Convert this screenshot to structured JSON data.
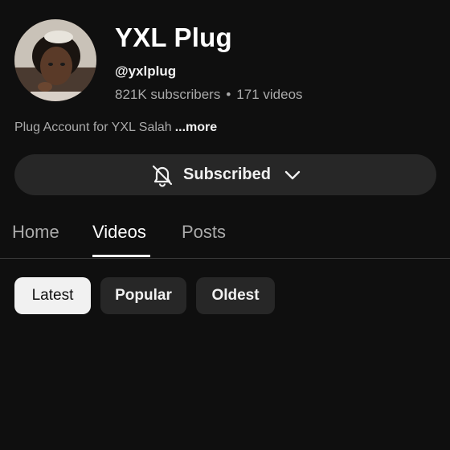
{
  "channel": {
    "name": "YXL Plug",
    "handle": "@yxlplug",
    "subscribers": "821K subscribers",
    "separator": "•",
    "videos": "171 videos",
    "description": "Plug Account for YXL Salah",
    "more_label": "...more",
    "avatar_icon": "profile-photo"
  },
  "subscribe_button": {
    "label": "Subscribed",
    "bell_icon": "bell-off-icon",
    "chevron_icon": "chevron-down-icon"
  },
  "tabs": [
    {
      "label": "Home",
      "active": false
    },
    {
      "label": "Videos",
      "active": true
    },
    {
      "label": "Posts",
      "active": false
    }
  ],
  "filters": [
    {
      "label": "Latest",
      "selected": true
    },
    {
      "label": "Popular",
      "selected": false
    },
    {
      "label": "Oldest",
      "selected": false
    }
  ],
  "colors": {
    "background": "#0f0f0f",
    "surface": "#272727",
    "text_primary": "#f1f1f1",
    "text_secondary": "#aaaaaa"
  }
}
